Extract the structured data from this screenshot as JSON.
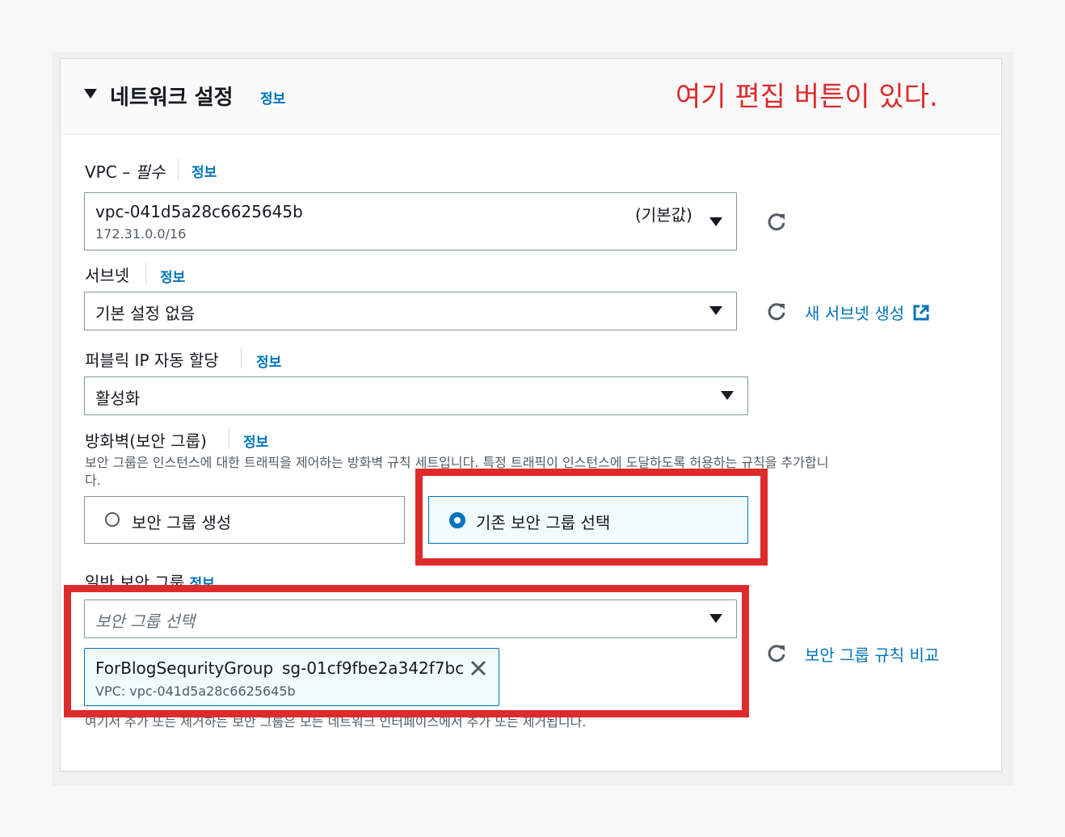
{
  "panel": {
    "title": "네트워크 설정",
    "info": "정보",
    "annotation": "여기 편집 버튼이 있다."
  },
  "vpc": {
    "label": "VPC – ",
    "required": "필수",
    "info": "정보",
    "value": "vpc-041d5a28c6625645b",
    "cidr": "172.31.0.0/16",
    "default_tag": "(기본값)"
  },
  "subnet": {
    "label": "서브넷",
    "info": "정보",
    "value": "기본 설정 없음",
    "create_link": "새 서브넷 생성"
  },
  "public_ip": {
    "label": "퍼블릭 IP 자동 할당",
    "info": "정보",
    "value": "활성화"
  },
  "firewall": {
    "label": "방화벽(보안 그룹)",
    "info": "정보",
    "description_line1": "보안 그룹은 인스턴스에 대한 트래픽을 제어하는 방화벽 규칙 세트입니다. 특정 트래픽이 인스턴스에 도달하도록 허용하는 규칙을 추가합니",
    "description_line2": "다.",
    "option_create": "보안 그룹 생성",
    "option_existing": "기존 보안 그룹 선택",
    "selected": "existing"
  },
  "common_sg": {
    "label": "일반 보안 그룹",
    "info": "정보",
    "placeholder": "보안 그룹 선택",
    "token_name": "ForBlogSequrityGroup",
    "token_id": "sg-01cf9fbe2a342f7bc",
    "token_vpc": "VPC: vpc-041d5a28c6625645b",
    "compare_link": "보안 그룹 규칙 비교",
    "footer_note": "여기서 추가 또는 제거하는 보안 그룹은 모든 네트워크 인터페이스에서 추가 또는 제거됩니다."
  },
  "colors": {
    "link": "#0073bb",
    "annotation_red": "#dd2a2a",
    "selected_bg": "#f1faff"
  }
}
